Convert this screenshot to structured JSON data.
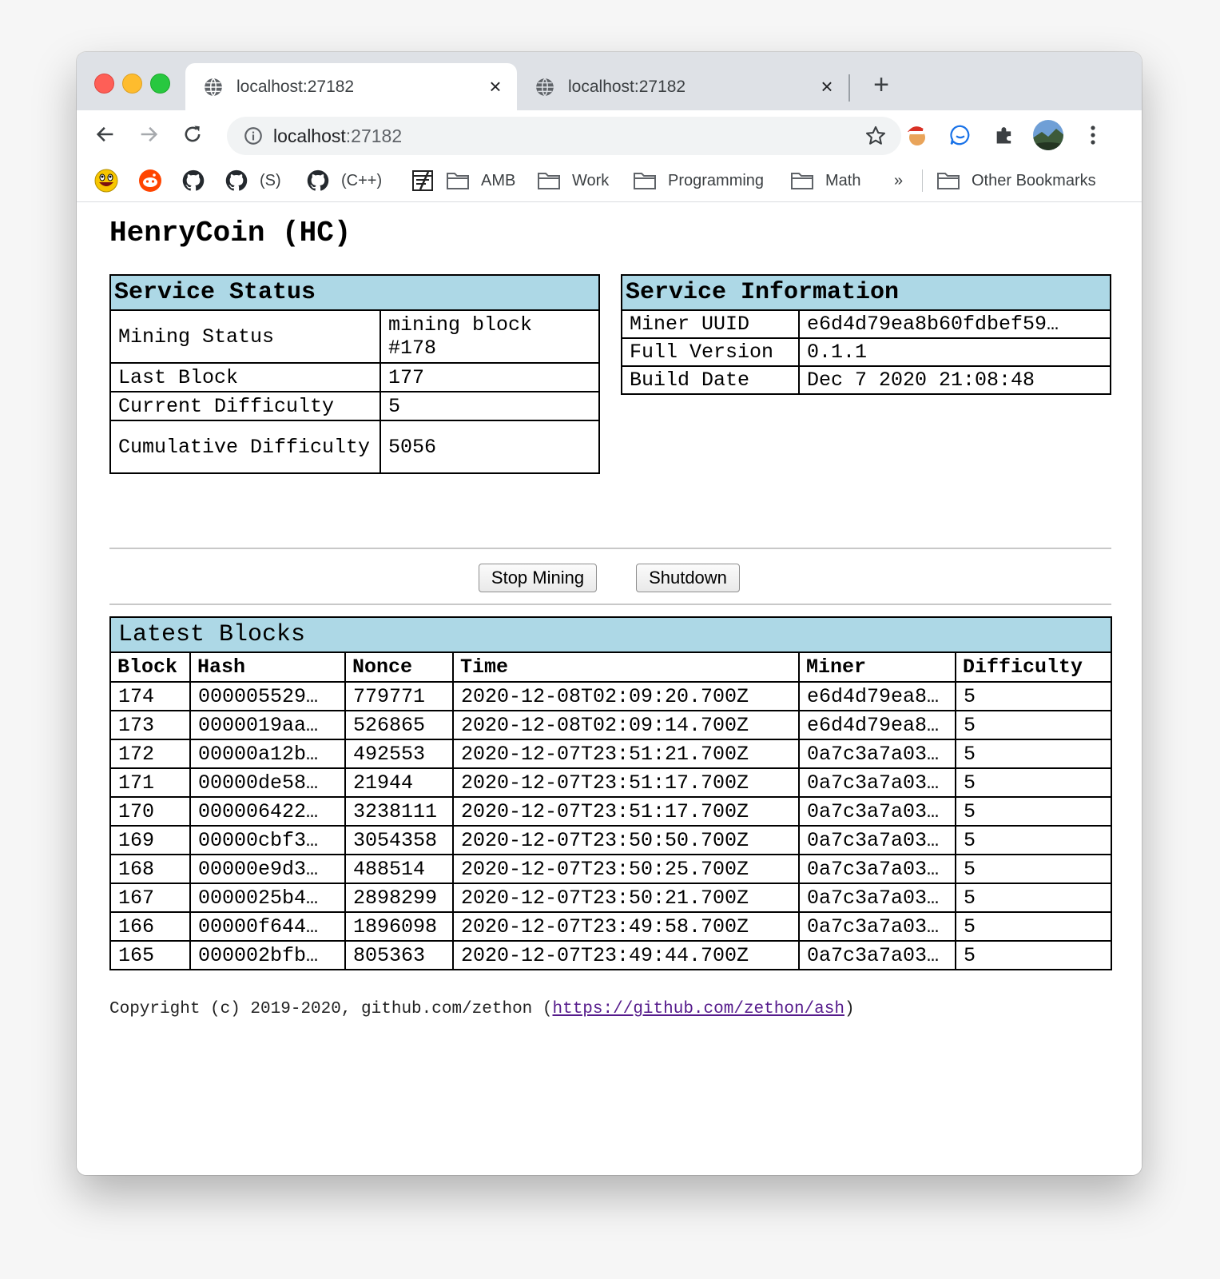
{
  "browser": {
    "tabs": [
      {
        "title": "localhost:27182",
        "close": "×"
      },
      {
        "title": "localhost:27182",
        "close": "×"
      }
    ],
    "new_tab": "+",
    "address": {
      "host": "localhost",
      "port": ":27182"
    },
    "bookmarks": [
      {
        "label": "",
        "icon": "awesome-face-icon"
      },
      {
        "label": "",
        "icon": "reddit-icon"
      },
      {
        "label": "",
        "icon": "github-icon"
      },
      {
        "label": "(S)",
        "icon": "github-icon"
      },
      {
        "label": "(C++)",
        "icon": "github-icon"
      },
      {
        "label": "",
        "icon": "notepad-icon"
      },
      {
        "label": "AMB",
        "icon": "folder-icon"
      },
      {
        "label": "Work",
        "icon": "folder-icon"
      },
      {
        "label": "Programming",
        "icon": "folder-icon"
      },
      {
        "label": "Math",
        "icon": "folder-icon"
      }
    ],
    "overflow": "»",
    "other_bookmarks": "Other Bookmarks"
  },
  "page": {
    "title": "HenryCoin (HC)",
    "service_status": {
      "heading": "Service Status",
      "rows": [
        {
          "label": "Mining Status",
          "value": "mining block #178"
        },
        {
          "label": "Last Block",
          "value": "177"
        },
        {
          "label": "Current Difficulty",
          "value": "5"
        },
        {
          "label": "Cumulative Difficulty",
          "value": "5056"
        }
      ]
    },
    "service_info": {
      "heading": "Service Information",
      "rows": [
        {
          "label": "Miner UUID",
          "value": "e6d4d79ea8b60fdbef59…"
        },
        {
          "label": "Full Version",
          "value": "0.1.1"
        },
        {
          "label": "Build Date",
          "value": "Dec 7 2020 21:08:48"
        }
      ]
    },
    "buttons": {
      "stop_mining": "Stop Mining",
      "shutdown": "Shutdown"
    },
    "latest_blocks": {
      "heading": "Latest Blocks",
      "columns": [
        "Block",
        "Hash",
        "Nonce",
        "Time",
        "Miner",
        "Difficulty"
      ],
      "rows": [
        [
          "174",
          "000005529…",
          "779771",
          "2020-12-08T02:09:20.700Z",
          "e6d4d79ea8…",
          "5"
        ],
        [
          "173",
          "0000019aa…",
          "526865",
          "2020-12-08T02:09:14.700Z",
          "e6d4d79ea8…",
          "5"
        ],
        [
          "172",
          "00000a12b…",
          "492553",
          "2020-12-07T23:51:21.700Z",
          "0a7c3a7a03…",
          "5"
        ],
        [
          "171",
          "00000de58…",
          "21944",
          "2020-12-07T23:51:17.700Z",
          "0a7c3a7a03…",
          "5"
        ],
        [
          "170",
          "000006422…",
          "3238111",
          "2020-12-07T23:51:17.700Z",
          "0a7c3a7a03…",
          "5"
        ],
        [
          "169",
          "00000cbf3…",
          "3054358",
          "2020-12-07T23:50:50.700Z",
          "0a7c3a7a03…",
          "5"
        ],
        [
          "168",
          "00000e9d3…",
          "488514",
          "2020-12-07T23:50:25.700Z",
          "0a7c3a7a03…",
          "5"
        ],
        [
          "167",
          "0000025b4…",
          "2898299",
          "2020-12-07T23:50:21.700Z",
          "0a7c3a7a03…",
          "5"
        ],
        [
          "166",
          "00000f644…",
          "1896098",
          "2020-12-07T23:49:58.700Z",
          "0a7c3a7a03…",
          "5"
        ],
        [
          "165",
          "000002bfb…",
          "805363",
          "2020-12-07T23:49:44.700Z",
          "0a7c3a7a03…",
          "5"
        ]
      ]
    },
    "footer": {
      "text_before": "Copyright (c) 2019-2020, github.com/zethon (",
      "link": "https://github.com/zethon/ash",
      "text_after": ")"
    }
  },
  "colors": {
    "panel_header": "#add8e6",
    "link_visited": "#551a8b",
    "tabstrip": "#dee1e6"
  }
}
